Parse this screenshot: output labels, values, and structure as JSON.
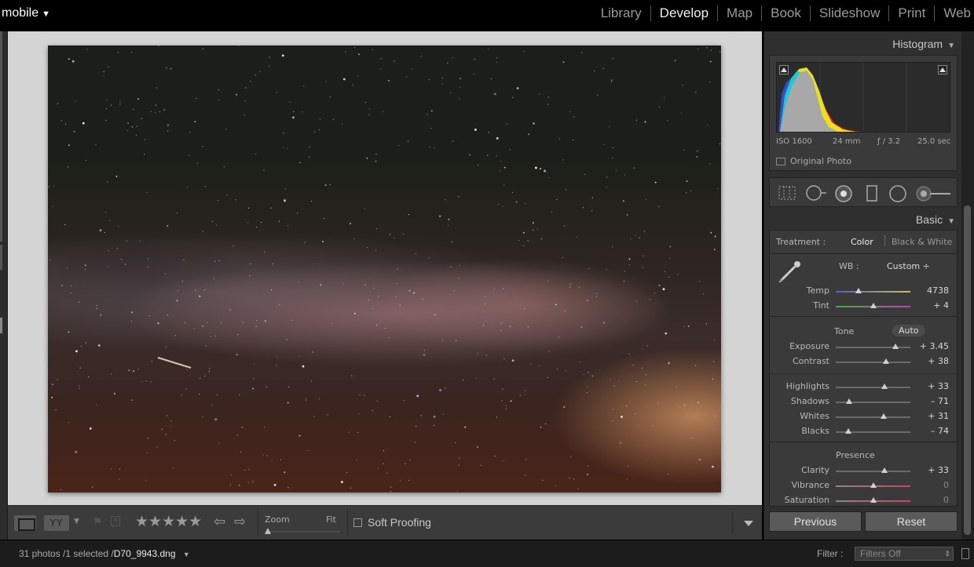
{
  "topbar": {
    "catalog_name": "mobile",
    "catalog_arrow": "▼",
    "modules": [
      "Library",
      "Develop",
      "Map",
      "Book",
      "Slideshow",
      "Print",
      "Web"
    ],
    "active_module": "Develop"
  },
  "toolbar": {
    "view_icon": "loupe-view-icon",
    "compare_label": "YY",
    "flag_icon": "flag-icon",
    "reject_icon": "reject-flag-icon",
    "stars": "★★★★★",
    "prev_arrow": "⇦",
    "next_arrow": "⇨",
    "zoom_label": "Zoom",
    "fit_label": "Fit",
    "soft_proofing_label": "Soft Proofing"
  },
  "histogram": {
    "title": "Histogram",
    "iso": "ISO 1600",
    "focal": "24 mm",
    "aperture": "ƒ / 3.2",
    "shutter": "25.0 sec",
    "original_photo_label": "Original Photo"
  },
  "basic": {
    "title": "Basic",
    "treatment_label": "Treatment :",
    "treatment_color": "Color",
    "treatment_bw": "Black & White",
    "wb_label": "WB :",
    "wb_value": "Custom ÷",
    "temp_label": "Temp",
    "temp_value": "4738",
    "temp_pos": 0.3,
    "tint_label": "Tint",
    "tint_value": "+ 4",
    "tint_pos": 0.51,
    "tone_label": "Tone",
    "auto_label": "Auto",
    "exposure_label": "Exposure",
    "exposure_value": "+ 3.45",
    "exposure_pos": 0.8,
    "contrast_label": "Contrast",
    "contrast_value": "+ 38",
    "contrast_pos": 0.67,
    "highlights_label": "Highlights",
    "highlights_value": "+ 33",
    "highlights_pos": 0.65,
    "shadows_label": "Shadows",
    "shadows_value": "– 71",
    "shadows_pos": 0.18,
    "whites_label": "Whites",
    "whites_value": "+ 31",
    "whites_pos": 0.64,
    "blacks_label": "Blacks",
    "blacks_value": "– 74",
    "blacks_pos": 0.17,
    "presence_label": "Presence",
    "clarity_label": "Clarity",
    "clarity_value": "+ 33",
    "clarity_pos": 0.65,
    "vibrance_label": "Vibrance",
    "vibrance_value": "0",
    "vibrance_pos": 0.5,
    "saturation_label": "Saturation",
    "saturation_value": "0",
    "saturation_pos": 0.5
  },
  "buttons": {
    "previous": "Previous",
    "reset": "Reset"
  },
  "status": {
    "count": "31 photos /1 selected /",
    "filename": "D70_9943.dng",
    "arrow": "▼",
    "filter_label": "Filter :",
    "filter_value": "Filters Off"
  },
  "colors": {
    "panel_bg": "#2f2f2f",
    "canvas_bg": "#d4d4d4"
  }
}
